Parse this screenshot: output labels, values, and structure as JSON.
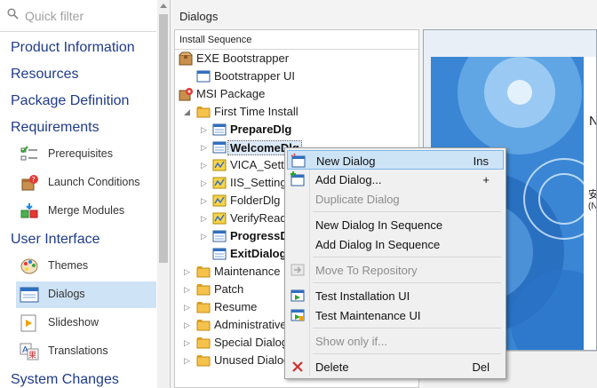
{
  "search": {
    "placeholder": "Quick filter"
  },
  "nav": {
    "product_information": "Product Information",
    "resources": "Resources",
    "package_definition": "Package Definition",
    "requirements": "Requirements",
    "prerequisites": "Prerequisites",
    "launch_conditions": "Launch Conditions",
    "merge_modules": "Merge Modules",
    "user_interface": "User Interface",
    "themes": "Themes",
    "dialogs": "Dialogs",
    "slideshow": "Slideshow",
    "translations": "Translations",
    "system_changes": "System Changes"
  },
  "main": {
    "title": "Dialogs",
    "tree_header": "Install Sequence",
    "tree": {
      "exe_bootstrapper": "EXE Bootstrapper",
      "bootstrapper_ui": "Bootstrapper UI",
      "msi_package": "MSI Package",
      "first_time_install": "First Time Install",
      "prepare_dlg": "PrepareDlg",
      "welcome_dlg": "WelcomeDlg",
      "vica_settings": "VICA_Settin",
      "iis_settings": "IIS_Setting",
      "folder_dlg": "FolderDlg",
      "verify_ready": "VerifyRead",
      "progress_dlg": "ProgressD",
      "exit_dialog": "ExitDialog",
      "maintenance": "Maintenance",
      "patch": "Patch",
      "resume": "Resume",
      "administrative": "Administrative",
      "special_dialogs": "Special Dialog",
      "unused_dialogs": "Unused Dialog"
    }
  },
  "preview": {
    "text1": "N",
    "text2": "安",
    "text3": "(N"
  },
  "context_menu": {
    "new_dialog": "New Dialog",
    "new_dialog_shortcut": "Ins",
    "add_dialog": "Add Dialog...",
    "add_dialog_shortcut": "+",
    "duplicate_dialog": "Duplicate Dialog",
    "new_dialog_in_sequence": "New Dialog In Sequence",
    "add_dialog_in_sequence": "Add Dialog In Sequence",
    "move_to_repository": "Move To Repository",
    "test_installation_ui": "Test Installation UI",
    "test_maintenance_ui": "Test Maintenance UI",
    "show_only_if": "Show only if...",
    "delete": "Delete",
    "delete_shortcut": "Del"
  },
  "colors": {
    "category_text": "#1f3b8a",
    "selection": "#cfe3f6",
    "menu_hover": "#cde4f7",
    "preview_blue": "#3a86d4"
  }
}
